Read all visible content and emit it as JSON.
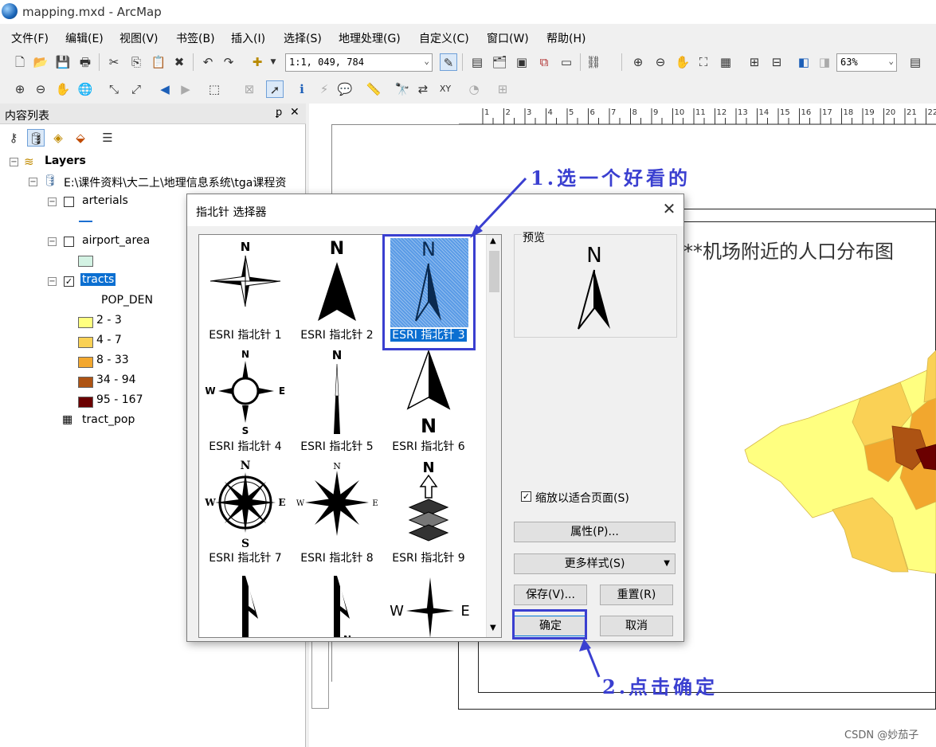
{
  "window": {
    "title": "mapping.mxd - ArcMap"
  },
  "menu": [
    "文件(F)",
    "编辑(E)",
    "视图(V)",
    "书签(B)",
    "插入(I)",
    "选择(S)",
    "地理处理(G)",
    "自定义(C)",
    "窗口(W)",
    "帮助(H)"
  ],
  "toolbar": {
    "scale_value": "1:1, 049, 784",
    "zoom_value": "63%"
  },
  "toc": {
    "title": "内容列表",
    "pin": "ᴾ",
    "close": "✕",
    "root": "Layers",
    "source": "E:\\课件资料\\大二上\\地理信息系统\\tga课程资",
    "layers": [
      {
        "name": "arterials",
        "checked": false
      },
      {
        "name": "airport_area",
        "checked": false
      },
      {
        "name": "tracts",
        "checked": true,
        "field": "POP_DEN",
        "classes": [
          {
            "label": "2 - 3",
            "color": "#ffff80"
          },
          {
            "label": "4 - 7",
            "color": "#fad155"
          },
          {
            "label": "8 - 33",
            "color": "#f2a72e"
          },
          {
            "label": "34 - 94",
            "color": "#ad5313"
          },
          {
            "label": "95 - 167",
            "color": "#6b0000"
          }
        ]
      }
    ],
    "table": "tract_pop"
  },
  "map": {
    "title": "**机场附近的人口分布图"
  },
  "dialog": {
    "title": "指北针 选择器",
    "symbols": [
      "ESRI 指北针 1",
      "ESRI 指北针 2",
      "ESRI 指北针 3",
      "ESRI 指北针 4",
      "ESRI 指北针 5",
      "ESRI 指北针 6",
      "ESRI 指北针 7",
      "ESRI 指北针 8",
      "ESRI 指北针 9"
    ],
    "selected": "ESRI 指北针 3",
    "preview_label": "预览",
    "scale_checkbox": "缩放以适合页面(S)",
    "properties_button": "属性(P)...",
    "more_styles_button": "更多样式(S)",
    "save_button": "保存(V)...",
    "reset_button": "重置(R)",
    "ok_button": "确定",
    "cancel_button": "取消"
  },
  "annotations": {
    "step1": "1.选一个好看的",
    "step2": "2.点击确定"
  },
  "watermark": "CSDN @妙茄子",
  "colors": {
    "annotation": "#3a3fd0",
    "selection": "#0b6fd1"
  }
}
